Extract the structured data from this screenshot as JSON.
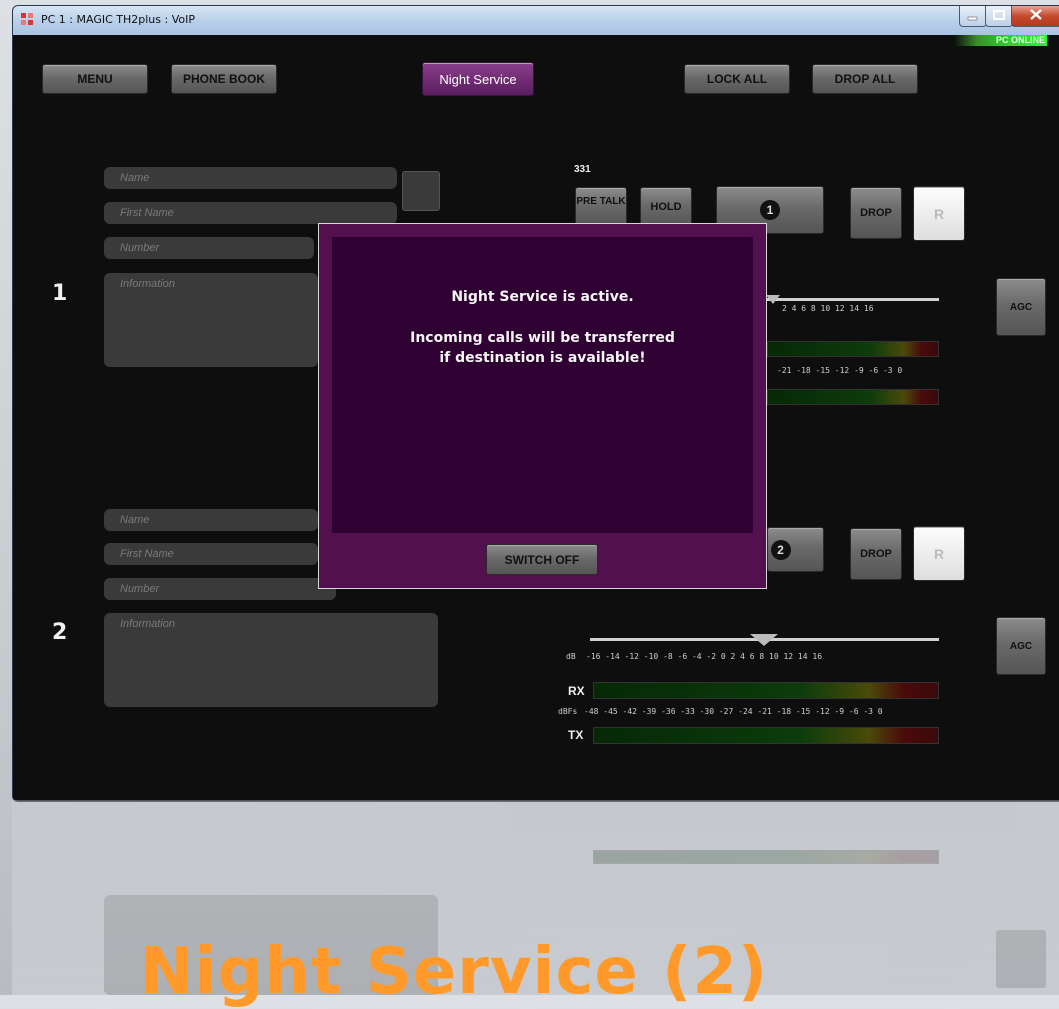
{
  "window": {
    "title": "PC 1 : MAGIC TH2plus : VoIP",
    "status": "PC ONLINE"
  },
  "toolbar": {
    "menu": "MENU",
    "phone_book": "PHONE BOOK",
    "night_service": "Night Service",
    "lock_all": "LOCK ALL",
    "drop_all": "DROP ALL"
  },
  "lines": [
    {
      "number_label": "1",
      "extension": "331",
      "name_placeholder": "Name",
      "first_name_placeholder": "First Name",
      "number_placeholder": "Number",
      "info_placeholder": "Information",
      "pre_talk": "PRE TALK",
      "hold": "HOLD",
      "call_badge": "1",
      "drop": "DROP",
      "r": "R",
      "agc": "AGC"
    },
    {
      "number_label": "2",
      "name_placeholder": "Name",
      "first_name_placeholder": "First Name",
      "number_placeholder": "Number",
      "info_placeholder": "Information",
      "call_badge": "2",
      "drop": "DROP",
      "r": "R",
      "agc": "AGC",
      "db_label": "dB",
      "db_ticks": "-16 -14 -12 -10 -8  -6  -4  -2  0   2   4   6   8  10  12  14  16",
      "rx": "RX",
      "tx": "TX",
      "dbfs_label": "dBFs",
      "dbfs_ticks": "-48 -45 -42 -39 -36 -33 -30 -27 -24 -21 -18 -15 -12 -9  -6  -3  0"
    }
  ],
  "line1_meter": {
    "db_ticks": "2   4   6   8  10  12  14  16",
    "dbfs_ticks": "-21 -18 -15 -12 -9  -6  -3  0"
  },
  "modal": {
    "line1": "Night Service is active.",
    "line2": "Incoming calls will be transferred",
    "line3": "if destination is available!",
    "switch_off": "SWITCH OFF"
  },
  "caption": "Night Service (2)",
  "colors": {
    "accent_purple": "#5a1d5e",
    "modal_bg": "#2f0132",
    "caption_orange": "#ff9a2a",
    "online_green": "#1fff1f"
  }
}
